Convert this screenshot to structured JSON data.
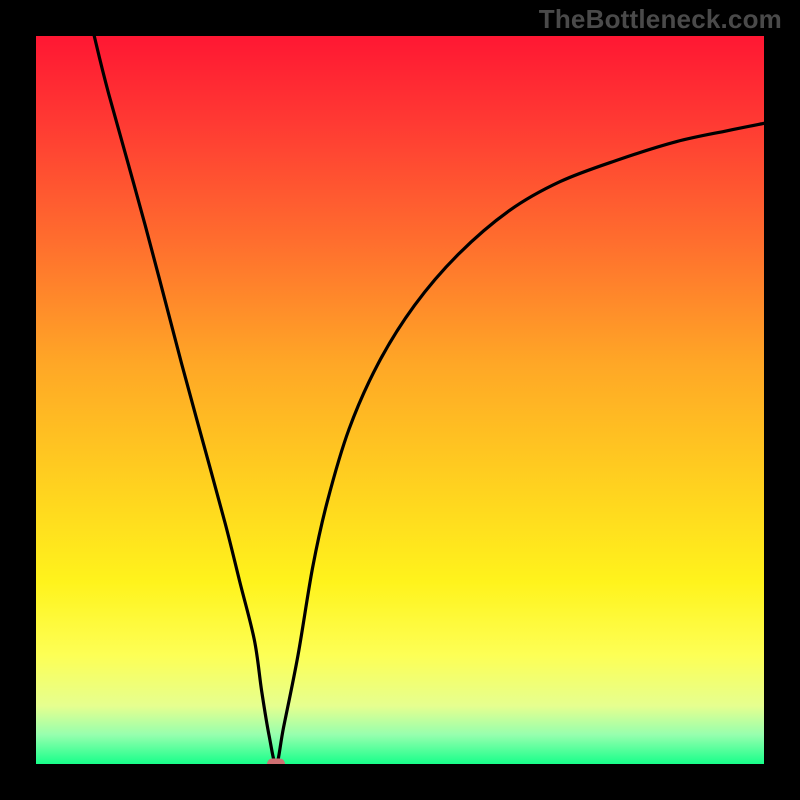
{
  "watermark": "TheBottleneck.com",
  "chart_data": {
    "type": "line",
    "title": "",
    "xlabel": "",
    "ylabel": "",
    "xlim": [
      0,
      100
    ],
    "ylim": [
      0,
      100
    ],
    "series": [
      {
        "name": "bottleneck-curve",
        "x": [
          8,
          10,
          15,
          20,
          23,
          26,
          28,
          30,
          31,
          32,
          33,
          34,
          36,
          38,
          40,
          43,
          47,
          52,
          58,
          65,
          72,
          80,
          88,
          95,
          100
        ],
        "values": [
          100,
          92,
          74,
          55,
          44,
          33,
          25,
          17,
          10,
          4,
          0,
          5,
          15,
          27,
          36,
          46,
          55,
          63,
          70,
          76,
          80,
          83,
          85.5,
          87,
          88
        ]
      }
    ],
    "background_gradient": {
      "stops": [
        {
          "offset": 0.0,
          "color": "#ff1733"
        },
        {
          "offset": 0.12,
          "color": "#ff3a33"
        },
        {
          "offset": 0.28,
          "color": "#ff6d2e"
        },
        {
          "offset": 0.45,
          "color": "#ffa726"
        },
        {
          "offset": 0.62,
          "color": "#ffd21f"
        },
        {
          "offset": 0.75,
          "color": "#fff31c"
        },
        {
          "offset": 0.85,
          "color": "#fdff55"
        },
        {
          "offset": 0.92,
          "color": "#e6ff8f"
        },
        {
          "offset": 0.96,
          "color": "#96ffae"
        },
        {
          "offset": 1.0,
          "color": "#18ff8a"
        }
      ]
    },
    "marker": {
      "x": 33,
      "y": 0,
      "color": "#cf6f72"
    }
  }
}
